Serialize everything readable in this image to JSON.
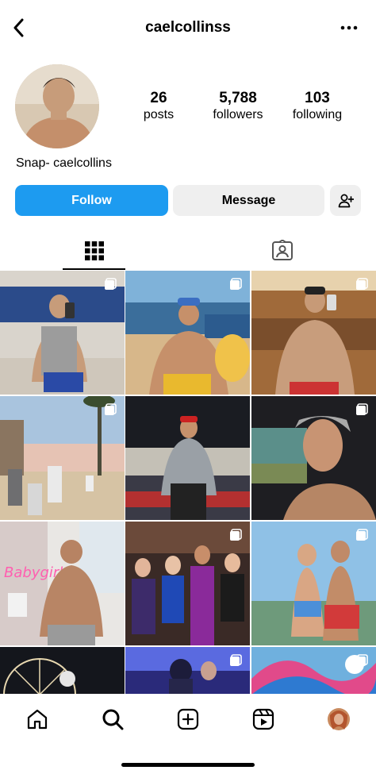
{
  "header": {
    "username": "caelcollinss",
    "back_icon": "chevron-left-icon",
    "more_icon": "ellipsis-icon"
  },
  "profile": {
    "stats": [
      {
        "value": "26",
        "label": "posts"
      },
      {
        "value": "5,788",
        "label": "followers"
      },
      {
        "value": "103",
        "label": "following"
      }
    ],
    "bio": "Snap- caelcollins"
  },
  "actions": {
    "follow_label": "Follow",
    "message_label": "Message",
    "add_user_icon": "add-user-icon"
  },
  "tabs": {
    "grid_icon": "grid-icon",
    "tagged_icon": "tagged-icon"
  },
  "nav": {
    "items": [
      "home-icon",
      "search-icon",
      "create-icon",
      "reels-icon",
      "profile-avatar"
    ]
  },
  "colors": {
    "follow_button": "#1d9bf0",
    "secondary_button": "#efefef"
  }
}
